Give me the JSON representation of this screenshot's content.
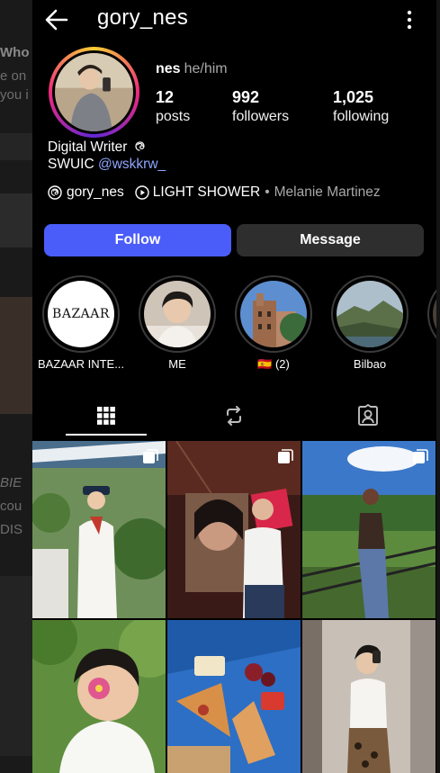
{
  "background": {
    "fragments": [
      "Who",
      "e on",
      "you i",
      "BIE",
      "cou",
      "DIS"
    ]
  },
  "header": {
    "title": "gory_nes",
    "back_icon": "arrow-left-icon",
    "more_icon": "more-vertical-icon"
  },
  "profile": {
    "display_name": "nes",
    "pronouns": "he/him",
    "stats": [
      {
        "value": "12",
        "label": "posts"
      },
      {
        "value": "992",
        "label": "followers"
      },
      {
        "value": "1,025",
        "label": "following"
      }
    ],
    "bio_line1": "Digital Writer",
    "bio_line2_prefix": "SWUIC",
    "bio_handle": "@wskkrw_",
    "threads_handle": "gory_nes",
    "song_title": "LIGHT SHOWER",
    "song_separator": "•",
    "song_artist": "Melanie Martinez"
  },
  "buttons": {
    "follow": "Follow",
    "message": "Message"
  },
  "highlights": [
    {
      "label": "BAZAAR INTE...",
      "logo_text": "BAZAAR"
    },
    {
      "label": "ME"
    },
    {
      "label": "🇪🇸 (2)"
    },
    {
      "label": "Bilbao"
    }
  ],
  "tabs": [
    {
      "name": "posts-grid",
      "icon": "grid-icon"
    },
    {
      "name": "reels",
      "icon": "repost-icon"
    },
    {
      "name": "tagged",
      "icon": "tagged-person-icon"
    }
  ],
  "colors": {
    "accent": "#4a5df9",
    "link": "#8fa6ff",
    "secondary_button": "#2e2e2e"
  }
}
